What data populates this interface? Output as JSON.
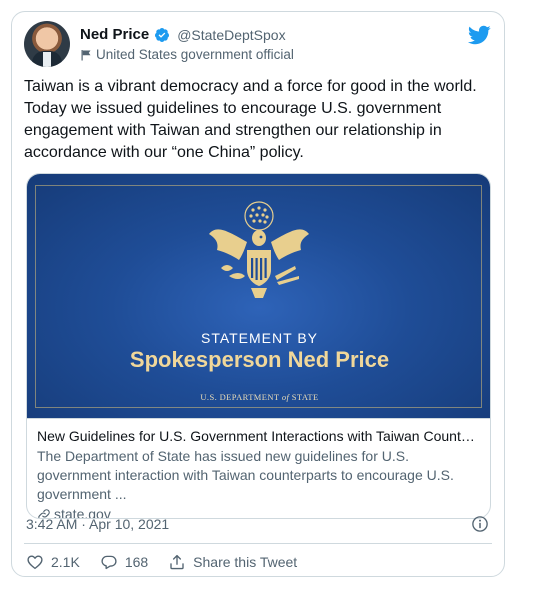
{
  "tweet": {
    "author": {
      "display_name": "Ned Price",
      "handle": "@StateDeptSpox",
      "affiliation": "United States government official"
    },
    "text": "Taiwan is a vibrant democracy and a force for good in the world. Today we issued guidelines to encourage U.S. government engagement with Taiwan and strengthen our relationship in accordance with our “one China” policy.",
    "link_card": {
      "image_label": "STATEMENT BY",
      "image_name": "Spokesperson Ned Price",
      "image_dept_prefix": "U.S. DEPARTMENT ",
      "image_dept_of": "of",
      "image_dept_suffix": " STATE",
      "title": "New Guidelines for U.S. Government Interactions with Taiwan Counterpar...",
      "description": "The Department of State has issued new guidelines for U.S. government interaction with Taiwan counterparts to encourage U.S. government ...",
      "domain": "state.gov"
    },
    "timestamp": "3:42 AM · Apr 10, 2021",
    "actions": {
      "likes": "2.1K",
      "replies": "168",
      "share_label": "Share this Tweet"
    }
  },
  "colors": {
    "twitter_blue": "#1d9bf0",
    "text_primary": "#0f1419",
    "text_secondary": "#536471",
    "border": "#cfd9de",
    "seal_gold": "#e8cf8e"
  },
  "icons": [
    "verified-badge-icon",
    "flag-icon",
    "twitter-bird-icon",
    "link-icon",
    "info-icon",
    "heart-icon",
    "reply-icon",
    "share-icon"
  ]
}
